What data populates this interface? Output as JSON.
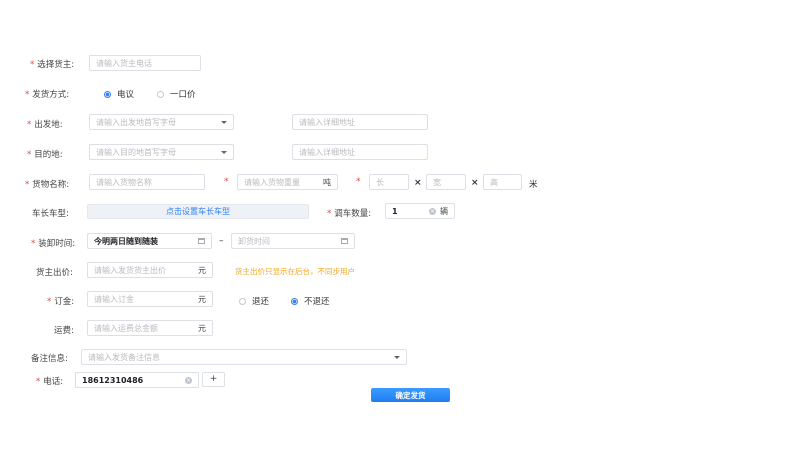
{
  "shipper": {
    "label": "选择货主:",
    "placeholder": "请输入货主电话"
  },
  "ship_method": {
    "label": "发货方式:",
    "options": [
      "电议",
      "一口价"
    ],
    "selected": "电议"
  },
  "origin": {
    "label": "出发地:",
    "select_placeholder": "请输入出发地首写字母",
    "detail_placeholder": "请输入详细地址"
  },
  "destination": {
    "label": "目的地:",
    "select_placeholder": "请输入目的地首写字母",
    "detail_placeholder": "请输入详细地址"
  },
  "cargo": {
    "label": "货物名称:",
    "name_placeholder": "请输入货物名称",
    "weight_placeholder": "请输入货物重量",
    "weight_unit": "吨",
    "length_placeholder": "长",
    "width_placeholder": "宽",
    "height_placeholder": "高",
    "times": "×",
    "dim_unit": "米"
  },
  "vehicle": {
    "label": "车长车型:",
    "button": "点击设置车长车型",
    "count_label": "调车数量:",
    "count_value": "1",
    "count_unit": "辆"
  },
  "loading": {
    "label": "装卸时间:",
    "start_value": "今明两日随到随装",
    "separator": "–",
    "end_placeholder": "卸货时间"
  },
  "price": {
    "label": "货主出价:",
    "placeholder": "请输入发货货主出价",
    "unit": "元",
    "hint": "货主出价只显示在后台，不同步用户"
  },
  "deposit": {
    "label": "订金:",
    "placeholder": "请输入订金",
    "unit": "元",
    "options": [
      "退还",
      "不退还"
    ],
    "selected": "不退还"
  },
  "freight": {
    "label": "运费:",
    "placeholder": "请输入运费总金额",
    "unit": "元"
  },
  "remark": {
    "label": "备注信息:",
    "placeholder": "请输入发货备注信息"
  },
  "phone": {
    "label": "电话:",
    "value": "18612310486",
    "add": "+"
  },
  "submit": {
    "label": "确定发货"
  },
  "colors": {
    "accent": "#2f7ff5",
    "required": "#e64545",
    "hint": "#f5a623"
  }
}
